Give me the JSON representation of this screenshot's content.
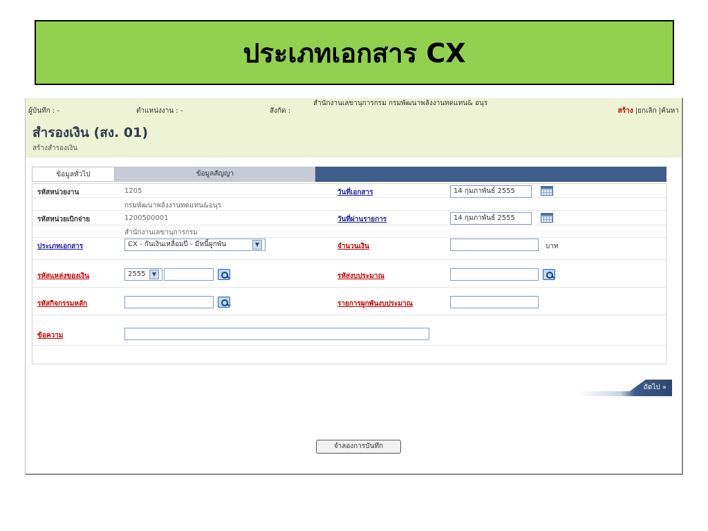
{
  "banner": {
    "title": "ประเภทเอกสาร CX"
  },
  "topbar": {
    "recorder": "ผู้บันทึก : -",
    "position": "ตำแหน่งงาน : -",
    "affiliation_label": "สังกัด :",
    "affiliation_value": "สำนักงานเลขานุการกรม กรมพัฒนาพลังงานทดแทน& อนุร",
    "actions": [
      "สร้าง",
      "|ยกเลิก",
      "|ค้นหา"
    ]
  },
  "header": {
    "title": "สำรองเงิน (สง. 01)",
    "subtitle": "สร้างสำรองเงิน"
  },
  "tabs": [
    "ข้อมูลทั่วไป",
    "ข้อมูลสัญญา"
  ],
  "form": {
    "agency_code_label": "รหัสหน่วยงาน",
    "agency_code": "1205",
    "agency_name": "กรมพัฒนาพลังงานทดแทน&อนุร",
    "disbursing_unit_label": "รหัสหน่วยเบิกจ่าย",
    "disbursing_unit_code": "1200500001",
    "disbursing_unit_name": "สำนักงานเลขานุการกรม",
    "doc_type_label": "ประเภทเอกสาร",
    "doc_type_value": "CX - กันเงินเหลื่อมปี - มีหนี้ผูกพัน",
    "fund_source_label": "รหัสแหล่งของเงิน",
    "fund_year": "2555",
    "activity_label": "รหัสกิจกรรมหลัก",
    "message_label": "ข้อความ",
    "doc_date_label": "วันที่เอกสาร",
    "doc_date": "14 กุมภาพันธ์ 2555",
    "post_date_label": "วันที่ผ่านรายการ",
    "post_date": "14 กุมภาพันธ์ 2555",
    "amount_label": "จำนวนเงิน",
    "amount_unit": "บาท",
    "budget_code_label": "รหัสงบประมาณ",
    "commitment_label": "รายการผูกพันงบประมาณ"
  },
  "buttons": {
    "next": "ถัดไป »",
    "simulate": "จำลองการบันทึก"
  }
}
